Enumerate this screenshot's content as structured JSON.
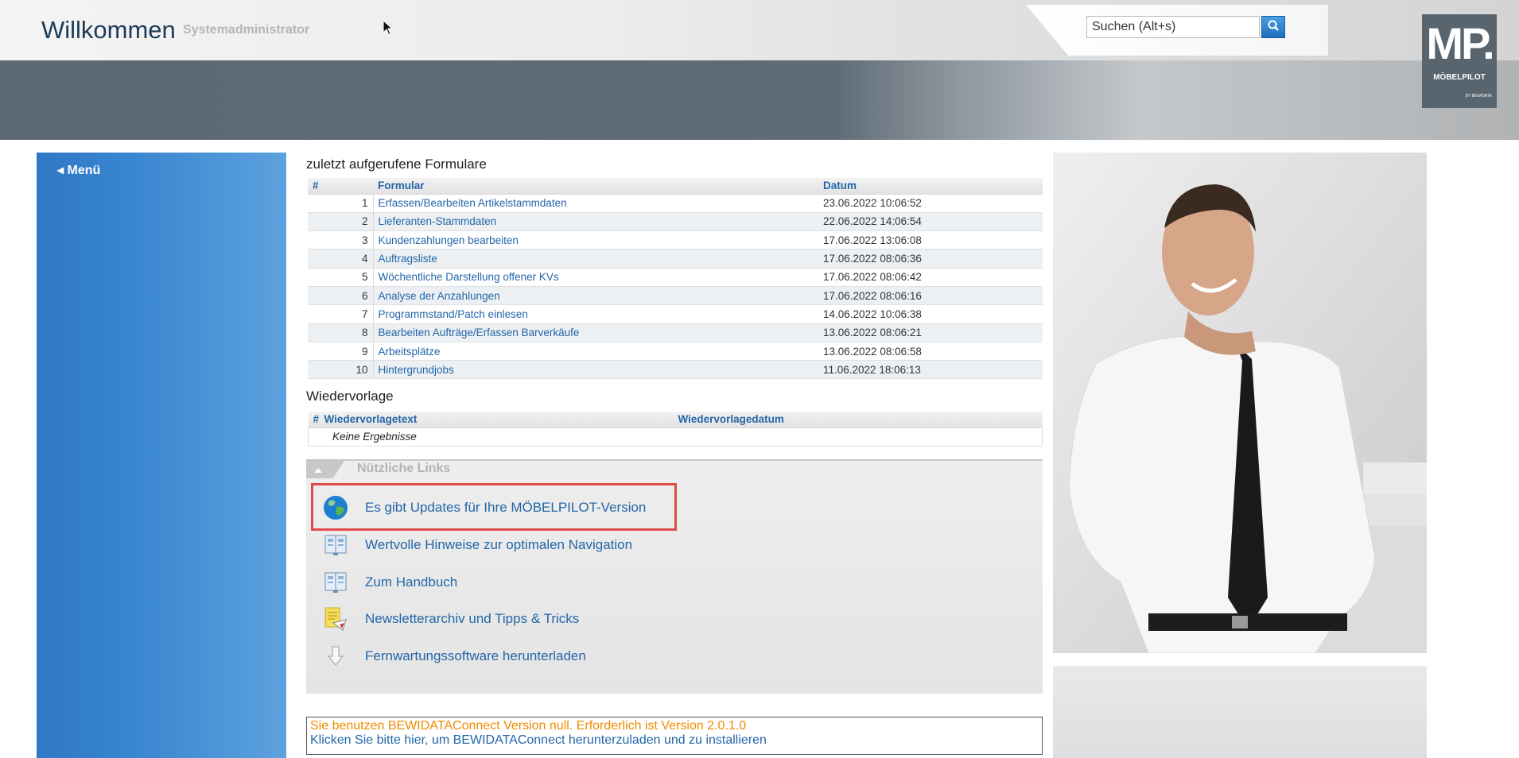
{
  "header": {
    "title": "Willkommen",
    "subtitle": "Systemadministrator",
    "search_placeholder": "Suchen (Alt+s)",
    "logo_mark": "MP.",
    "logo_name": "MÖBELPILOT",
    "logo_by": "BY BEWIDATA"
  },
  "sidebar": {
    "menu_label": "Menü"
  },
  "recent": {
    "title": "zuletzt aufgerufene Formulare",
    "columns": [
      "#",
      "Formular",
      "Datum"
    ],
    "rows": [
      {
        "n": "1",
        "form": "Erfassen/Bearbeiten Artikelstammdaten",
        "date": "23.06.2022 10:06:52"
      },
      {
        "n": "2",
        "form": "Lieferanten-Stammdaten",
        "date": "22.06.2022 14:06:54"
      },
      {
        "n": "3",
        "form": "Kundenzahlungen bearbeiten",
        "date": "17.06.2022 13:06:08"
      },
      {
        "n": "4",
        "form": "Auftragsliste",
        "date": "17.06.2022 08:06:36"
      },
      {
        "n": "5",
        "form": "Wöchentliche Darstellung offener KVs",
        "date": "17.06.2022 08:06:42"
      },
      {
        "n": "6",
        "form": "Analyse der Anzahlungen",
        "date": "17.06.2022 08:06:16"
      },
      {
        "n": "7",
        "form": "Programmstand/Patch einlesen",
        "date": "14.06.2022 10:06:38"
      },
      {
        "n": "8",
        "form": "Bearbeiten Aufträge/Erfassen Barverkäufe",
        "date": "13.06.2022 08:06:21"
      },
      {
        "n": "9",
        "form": "Arbeitsplätze",
        "date": "13.06.2022 08:06:58"
      },
      {
        "n": "10",
        "form": "Hintergrundjobs",
        "date": "11.06.2022 18:06:13"
      }
    ]
  },
  "resubmission": {
    "title": "Wiedervorlage",
    "columns": [
      "#",
      "Wiedervorlagetext",
      "Wiedervorlagedatum"
    ],
    "empty_text": "Keine Ergebnisse"
  },
  "links": {
    "title": "Nützliche Links",
    "items": [
      {
        "label": "Es gibt Updates für Ihre MÖBELPILOT-Version",
        "icon": "globe-icon"
      },
      {
        "label": "Wertvolle Hinweise zur optimalen Navigation",
        "icon": "book-icon"
      },
      {
        "label": "Zum Handbuch",
        "icon": "book-icon"
      },
      {
        "label": "Newsletterarchiv und Tipps & Tricks",
        "icon": "newsletter-icon"
      },
      {
        "label": "Fernwartungssoftware herunterladen",
        "icon": "download-arrow-icon"
      }
    ]
  },
  "notice": {
    "line1": "Sie benutzen BEWIDATAConnect Version null. Erforderlich ist Version 2.0.1.0",
    "line2": "Klicken Sie bitte hier, um BEWIDATAConnect herunterzuladen und zu installieren"
  },
  "colors": {
    "accent_blue": "#2366a8",
    "sidebar_blue": "#3a86d0",
    "highlight_red": "#e24a4a",
    "warning_orange": "#f08a00"
  }
}
